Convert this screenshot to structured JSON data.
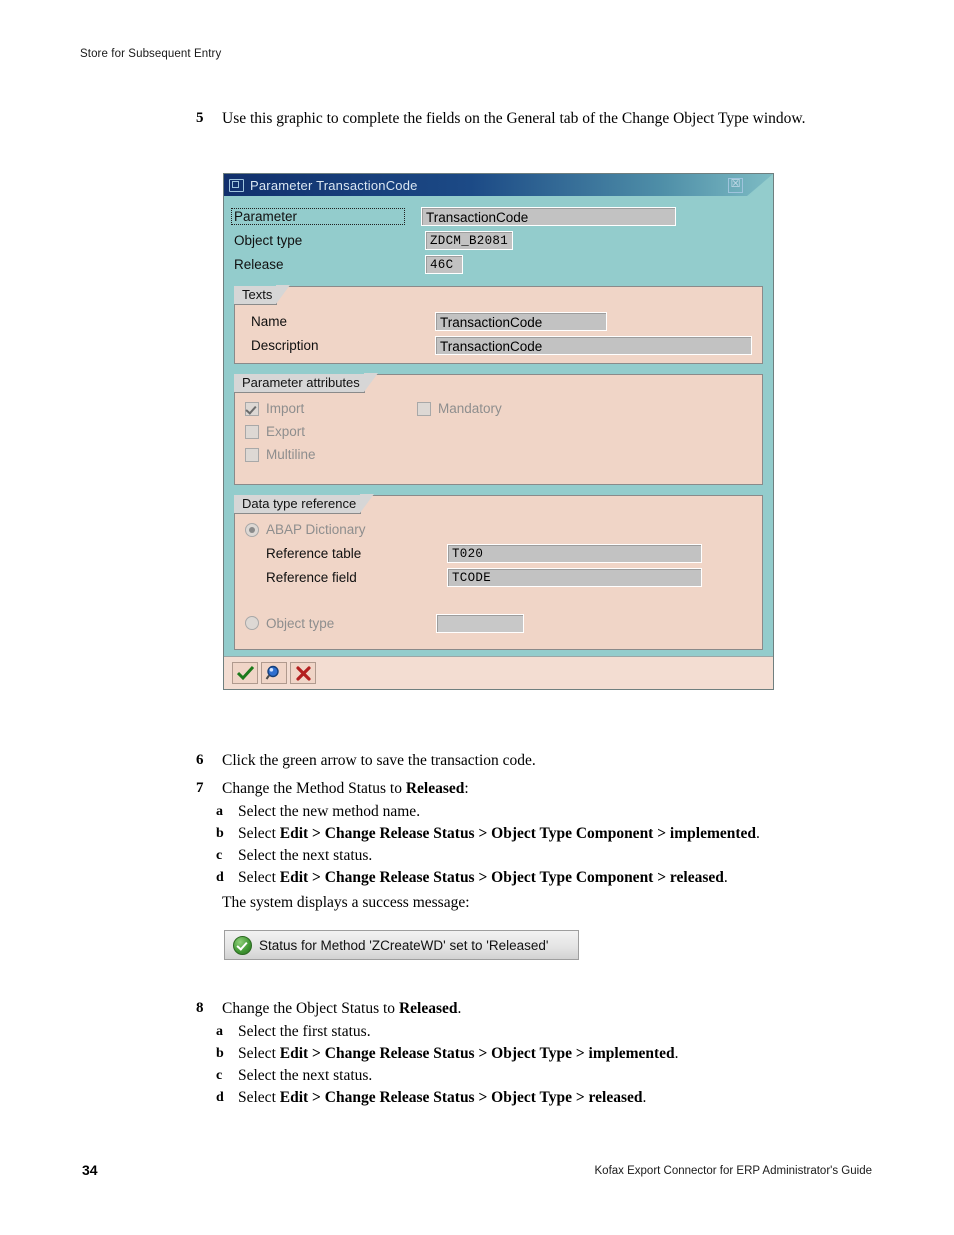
{
  "page": {
    "running_head": "Store for Subsequent Entry",
    "number": "34",
    "footer": "Kofax Export Connector for ERP Administrator's Guide"
  },
  "steps": {
    "s5": {
      "num": "5",
      "text": "Use this graphic to complete the fields on the General tab of the Change Object Type window."
    },
    "s6": {
      "num": "6",
      "text": "Click the green arrow to save the transaction code."
    },
    "s7": {
      "num": "7",
      "lead_pre": "Change the Method Status to ",
      "lead_bold": "Released",
      "lead_post": ":",
      "a": {
        "letter": "a",
        "text": "Select the new method name."
      },
      "b": {
        "letter": "b",
        "pre": "Select ",
        "bold": "Edit > Change Release Status > Object Type Component > implemented",
        "post": "."
      },
      "c": {
        "letter": "c",
        "text": "Select the next status."
      },
      "d": {
        "letter": "d",
        "pre": "Select ",
        "bold": "Edit > Change Release Status > Object Type Component > released",
        "post": "."
      },
      "trailer": "The system displays a success message:"
    },
    "s8": {
      "num": "8",
      "lead_pre": "Change the Object Status to ",
      "lead_bold": "Released",
      "lead_post": ".",
      "a": {
        "letter": "a",
        "text": "Select the first status."
      },
      "b": {
        "letter": "b",
        "pre": "Select ",
        "bold": "Edit > Change Release Status > Object Type > implemented",
        "post": "."
      },
      "c": {
        "letter": "c",
        "text": "Select the next status."
      },
      "d": {
        "letter": "d",
        "pre": "Select ",
        "bold": "Edit > Change Release Status > Object Type > released",
        "post": "."
      }
    }
  },
  "dialog": {
    "title": "Parameter TransactionCode",
    "close_label": "☒",
    "fields": {
      "parameter": {
        "label": "Parameter",
        "value": "TransactionCode"
      },
      "object_type": {
        "label": "Object type",
        "value": "ZDCM_B2081"
      },
      "release": {
        "label": "Release",
        "value": "46C"
      }
    },
    "texts_group": {
      "title": "Texts",
      "name": {
        "label": "Name",
        "value": "TransactionCode"
      },
      "description": {
        "label": "Description",
        "value": "TransactionCode"
      }
    },
    "attributes_group": {
      "title": "Parameter attributes",
      "import": {
        "label": "Import",
        "checked": true
      },
      "export": {
        "label": "Export",
        "checked": false
      },
      "multiline": {
        "label": "Multiline",
        "checked": false
      },
      "mandatory": {
        "label": "Mandatory",
        "checked": false
      }
    },
    "datatype_group": {
      "title": "Data type reference",
      "abap_dictionary": {
        "label": "ABAP Dictionary",
        "selected": true
      },
      "reference_table": {
        "label": "Reference table",
        "value": "T020"
      },
      "reference_field": {
        "label": "Reference field",
        "value": "TCODE"
      },
      "object_type_radio": {
        "label": "Object type",
        "selected": false,
        "value": ""
      }
    },
    "toolbar": {
      "confirm_label": "✔",
      "search_label": "⚲",
      "cancel_label": "✖"
    },
    "colors": {
      "background": "#93cccc",
      "group": "#f0d5c7",
      "input": "#c2c2c2",
      "title_start": "#11306c"
    }
  },
  "status_message": {
    "text": "Status for Method 'ZCreateWD' set to 'Released'",
    "icon": "success-check-icon"
  }
}
